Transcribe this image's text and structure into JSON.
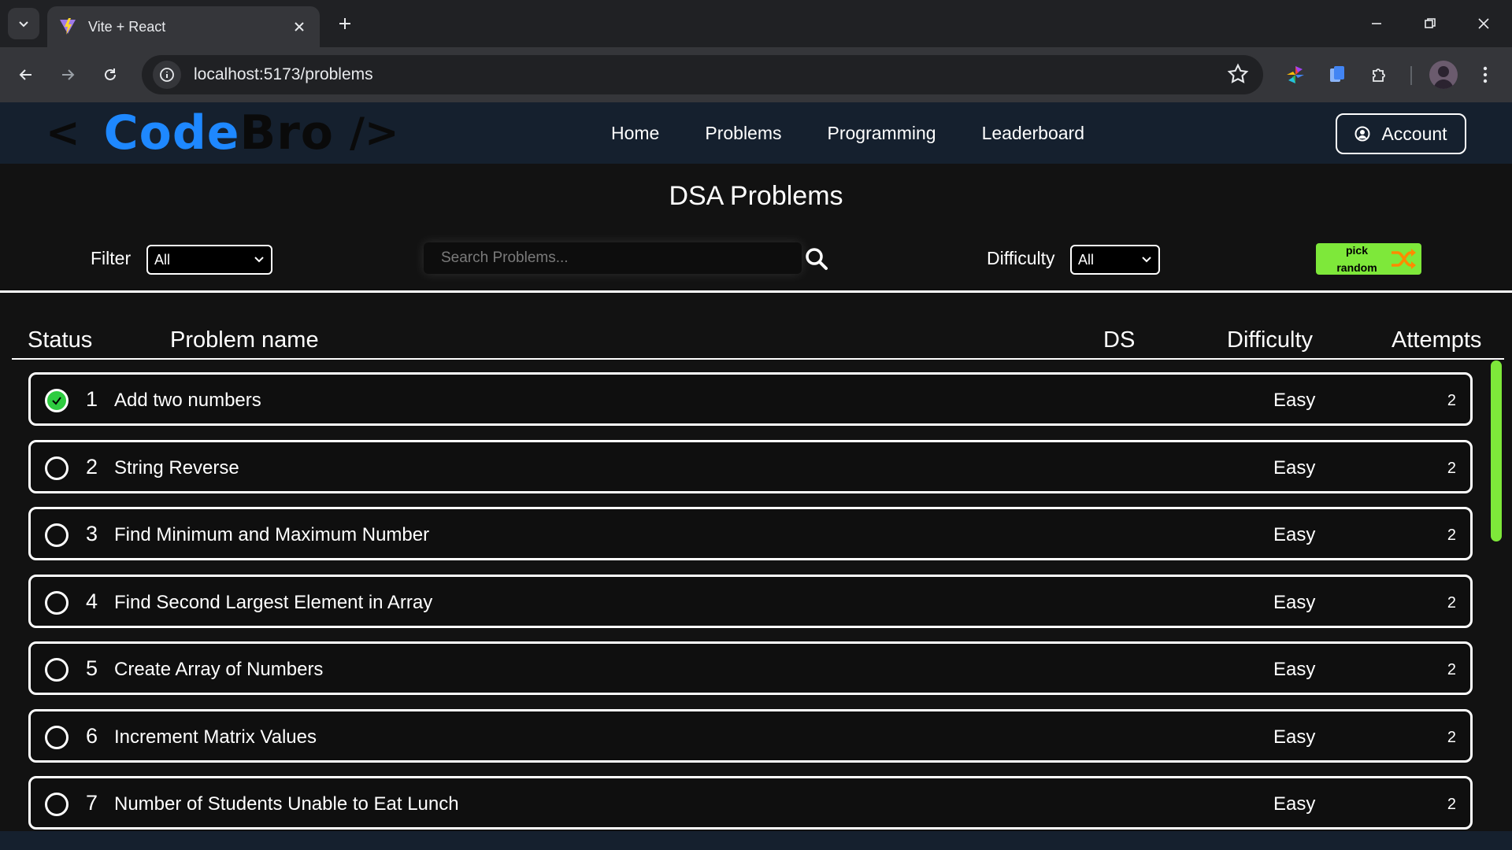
{
  "browser": {
    "tab_title": "Vite + React",
    "url": "localhost:5173/problems"
  },
  "nav": {
    "logo_open": "<",
    "logo_code": "Code",
    "logo_bro": "Bro",
    "logo_close": "/>",
    "links": [
      "Home",
      "Problems",
      "Programming",
      "Leaderboard"
    ],
    "account_label": "Account"
  },
  "main": {
    "title": "DSA Problems",
    "filter_label": "Filter",
    "filter_value": "All",
    "search_placeholder": "Search Problems...",
    "difficulty_label": "Difficulty",
    "difficulty_value": "All",
    "pick_random_line1": "pick",
    "pick_random_line2": "random"
  },
  "table": {
    "headers": {
      "status": "Status",
      "name": "Problem name",
      "ds": "DS",
      "difficulty": "Difficulty",
      "attempts": "Attempts"
    },
    "rows": [
      {
        "num": "1",
        "name": "Add two numbers",
        "difficulty": "Easy",
        "attempts": "2",
        "solved": true
      },
      {
        "num": "2",
        "name": "String Reverse",
        "difficulty": "Easy",
        "attempts": "2",
        "solved": false
      },
      {
        "num": "3",
        "name": "Find Minimum and Maximum Number",
        "difficulty": "Easy",
        "attempts": "2",
        "solved": false
      },
      {
        "num": "4",
        "name": "Find Second Largest Element in Array",
        "difficulty": "Easy",
        "attempts": "2",
        "solved": false
      },
      {
        "num": "5",
        "name": "Create Array of Numbers",
        "difficulty": "Easy",
        "attempts": "2",
        "solved": false
      },
      {
        "num": "6",
        "name": "Increment Matrix Values",
        "difficulty": "Easy",
        "attempts": "2",
        "solved": false
      },
      {
        "num": "7",
        "name": "Number of Students Unable to Eat Lunch",
        "difficulty": "Easy",
        "attempts": "2",
        "solved": false
      }
    ]
  },
  "colors": {
    "accent_green": "#7ee83a",
    "solved_green": "#2ecc40",
    "logo_blue": "#1e88ff",
    "nav_bg": "#15202e"
  }
}
